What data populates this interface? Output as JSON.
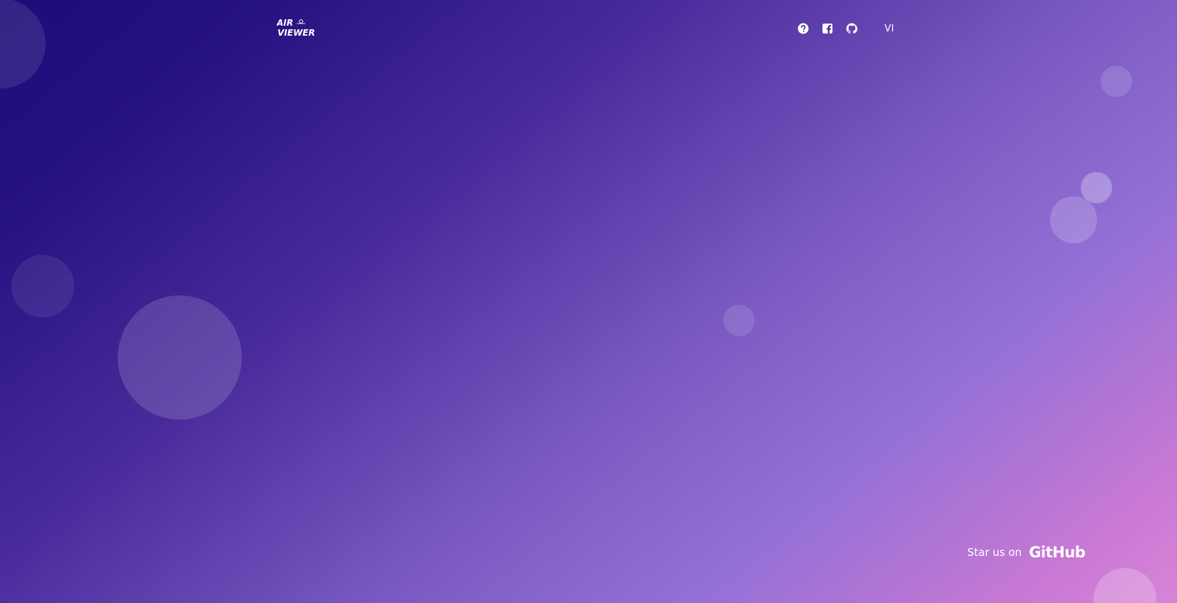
{
  "brand": {
    "logo_line1": "AIR",
    "logo_line2": "VIEWER"
  },
  "nav": {
    "icons": [
      "help-circle-icon",
      "facebook-icon",
      "github-icon"
    ],
    "language": "VI"
  },
  "footer": {
    "star_text": "Star us on",
    "github_label": "GitHub"
  },
  "colors": {
    "gradient_start": "#1e0b78",
    "gradient_mid": "#9370d6",
    "gradient_end": "#d884d8",
    "text": "#ffffff"
  }
}
